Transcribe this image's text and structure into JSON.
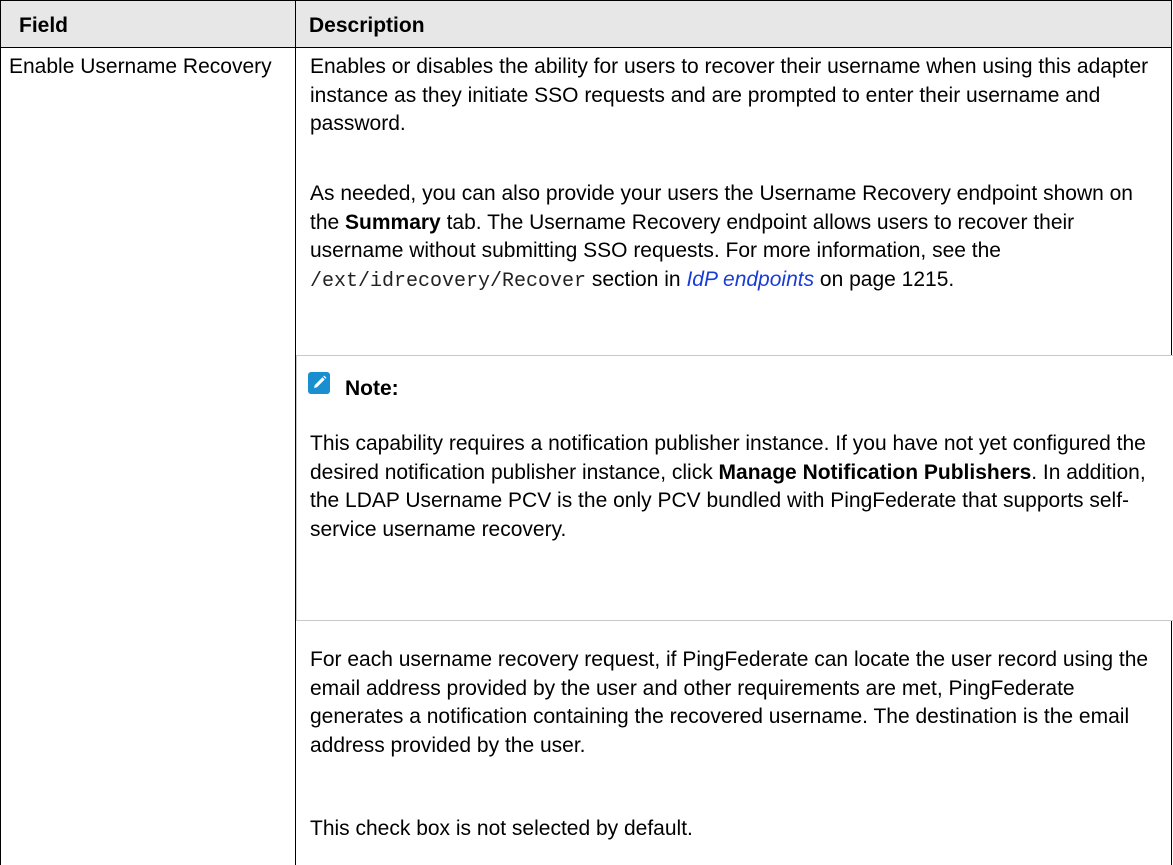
{
  "header": {
    "field": "Field",
    "description": "Description"
  },
  "row": {
    "field": "Enable Username Recovery",
    "p1": "Enables or disables the ability for users to recover their username when using this adapter instance as they initiate SSO requests and are prompted to enter their username and password.",
    "p2": {
      "pre": "As needed, you can also provide your users the Username Recovery endpoint shown on the ",
      "bold": "Summary",
      "mid": " tab. The Username Recovery endpoint allows users to recover their username without submitting SSO requests. For more information, see the ",
      "code": "/ext/idrecovery/Recover",
      "post1": " section in ",
      "link": "IdP endpoints",
      "post2": " on page 1215."
    },
    "note": {
      "icon": "pencil-icon",
      "title": "Note:",
      "pre": "This capability requires a notification publisher instance. If you have not yet configured the desired notification publisher instance, click ",
      "bold": "Manage Notification Publishers",
      "post": ". In addition, the LDAP Username PCV is the only PCV bundled with PingFederate that supports self-service username recovery."
    },
    "p3": "For each username recovery request, if PingFederate can locate the user record using the email address provided by the user and other requirements are met, PingFederate generates a notification containing the recovered username. The destination is the email address provided by the user.",
    "p4": "This check box is not selected by default."
  },
  "colors": {
    "header_bg": "#e7e7e7",
    "link": "#1a3cd6",
    "note_icon": "#1a8fd0"
  }
}
